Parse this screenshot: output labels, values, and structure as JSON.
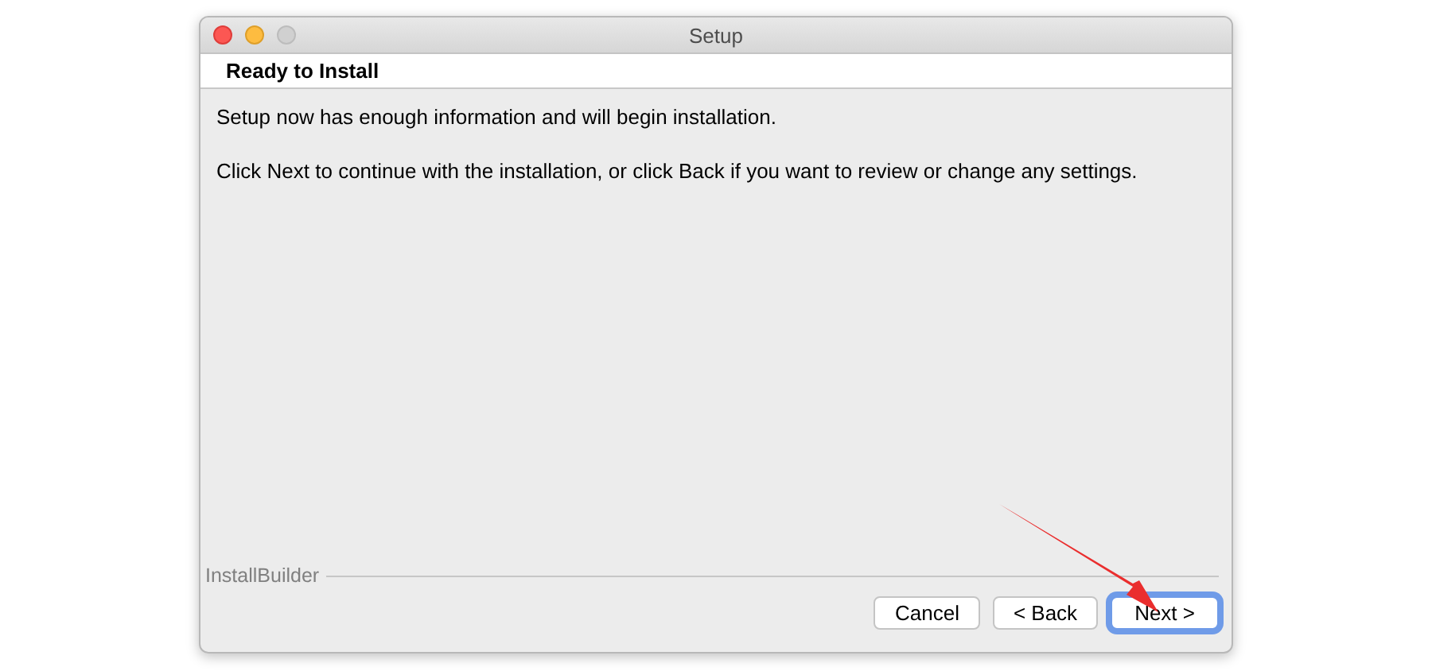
{
  "window": {
    "title": "Setup"
  },
  "header": {
    "title": "Ready to Install"
  },
  "paragraphs": [
    "Setup now has enough information and will begin installation.",
    "Click Next to continue with the installation, or click Back if you want to review or change any settings."
  ],
  "footer": {
    "brand": "InstallBuilder"
  },
  "buttons": [
    {
      "label": "Cancel",
      "default": false
    },
    {
      "label": "< Back",
      "default": false
    },
    {
      "label": "Next >",
      "default": true
    }
  ]
}
